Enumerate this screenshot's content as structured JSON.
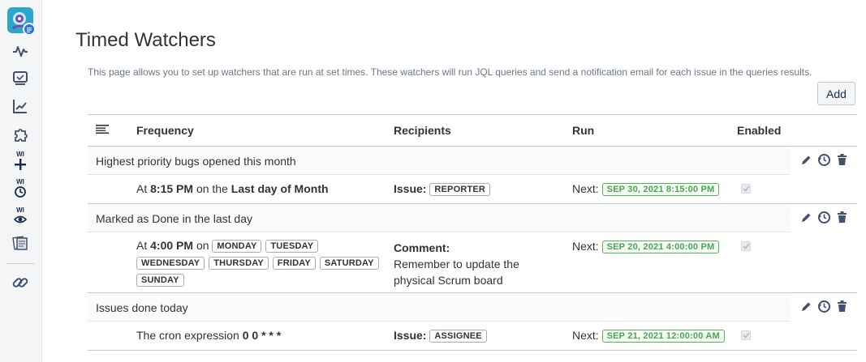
{
  "sidebar": {
    "icons": [
      "app-logo-icon",
      "pulse-icon",
      "monitor-icon",
      "chart-icon",
      "puzzle-icon",
      "wi-add-icon",
      "wi-clock-icon",
      "wi-eye-icon",
      "documents-icon",
      "link-icon"
    ],
    "wi_label": "WI"
  },
  "page": {
    "title": "Timed Watchers",
    "description": "This page allows you to set up watchers that are run at set times. These watchers will run JQL queries and send a notification email for each issue in the queries results.",
    "add_label": "Add"
  },
  "table": {
    "headers": {
      "frequency": "Frequency",
      "recipients": "Recipients",
      "run": "Run",
      "enabled": "Enabled"
    },
    "next_label": "Next:",
    "rows": [
      {
        "title": "Highest priority bugs opened this month",
        "freq_prefix": "At",
        "time": "8:15 PM",
        "freq_mid": "on the",
        "freq_day": "Last day of Month",
        "recipient_label": "Issue:",
        "recipient_tag": "REPORTER",
        "next_run": "SEP 30, 2021 8:15:00 PM",
        "enabled": true
      },
      {
        "title": "Marked as Done in the last day",
        "freq_prefix": "At",
        "time": "4:00 PM",
        "freq_mid": "on",
        "days": [
          "MONDAY",
          "TUESDAY",
          "WEDNESDAY",
          "THURSDAY",
          "FRIDAY",
          "SATURDAY",
          "SUNDAY"
        ],
        "recipient_label": "Comment:",
        "recipient_text_1": "Remember to update the",
        "recipient_text_2": "physical Scrum board",
        "next_run": "SEP 20, 2021 4:00:00 PM",
        "enabled": true
      },
      {
        "title": "Issues done today",
        "freq_prefix": "The cron expression",
        "cron": "0 0 * * *",
        "recipient_label": "Issue:",
        "recipient_tag": "ASSIGNEE",
        "next_run": "SEP 21, 2021 12:00:00 AM",
        "enabled": true
      }
    ]
  },
  "colors": {
    "lozenge_green": "#4aa553",
    "sidebar_bg": "#f4f5f7",
    "logo_teal": "#2ba8c9"
  }
}
